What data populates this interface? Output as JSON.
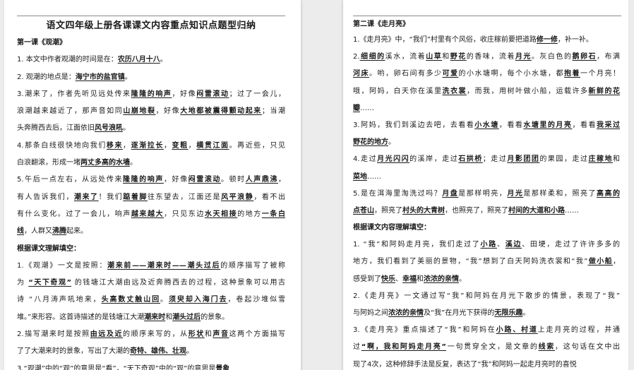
{
  "left": {
    "title": "语文四年级上册各课课文内容重点知识点题型归纳",
    "lines": [
      {
        "type": "heading",
        "segs": [
          {
            "t": "第一课《观潮》"
          }
        ]
      },
      {
        "segs": [
          {
            "t": "1. 本文中作者观潮的时间是在："
          },
          {
            "t": "农历八月十八",
            "u": true
          },
          {
            "t": "。"
          }
        ],
        "last": true
      },
      {
        "segs": [
          {
            "t": "2. 观潮的地点是："
          },
          {
            "t": "海宁市的盐官镇",
            "u": true
          },
          {
            "t": "。"
          }
        ],
        "last": true
      },
      {
        "segs": [
          {
            "t": "3.潮来了，作者先听见远处传来"
          },
          {
            "t": "隆隆的响声",
            "u": true
          },
          {
            "t": "，好像"
          },
          {
            "t": "闷雷滚动",
            "u": true
          },
          {
            "t": "；过了一会儿，"
          }
        ]
      },
      {
        "segs": [
          {
            "t": "浪潮越来越近了，那声音如同"
          },
          {
            "t": "山崩地裂",
            "u": true
          },
          {
            "t": "，好像"
          },
          {
            "t": "大地都被震得颤动起来",
            "u": true
          },
          {
            "t": "；当潮"
          }
        ]
      },
      {
        "segs": [
          {
            "t": "头奔腾西去后，江面依旧"
          },
          {
            "t": "风号浪吼",
            "u": true
          },
          {
            "t": "。"
          }
        ],
        "last": true
      },
      {
        "segs": [
          {
            "t": "4.那条白线很快地向我们"
          },
          {
            "t": "移来",
            "u": true
          },
          {
            "t": "，"
          },
          {
            "t": "逐渐拉长",
            "u": true
          },
          {
            "t": "，"
          },
          {
            "t": "变粗",
            "u": true
          },
          {
            "t": "，"
          },
          {
            "t": "横贯江面",
            "u": true
          },
          {
            "t": "。再近些，只见"
          }
        ]
      },
      {
        "segs": [
          {
            "t": "白浪翻滚，形成一堵"
          },
          {
            "t": "两丈多高的水墙",
            "u": true
          },
          {
            "t": "。"
          }
        ],
        "last": true
      },
      {
        "segs": [
          {
            "t": "5.午后一点左右，从远处传来"
          },
          {
            "t": "隆隆的响声",
            "u": true
          },
          {
            "t": "，好像"
          },
          {
            "t": "闷雷滚动",
            "u": true
          },
          {
            "t": "。顿时"
          },
          {
            "t": "人声鼎沸",
            "u": true
          },
          {
            "t": "，"
          }
        ]
      },
      {
        "segs": [
          {
            "t": "有人告诉我们，"
          },
          {
            "t": "潮来了",
            "u": true
          },
          {
            "t": "！我们"
          },
          {
            "t": "踮着脚",
            "u": true
          },
          {
            "t": "往东望去，江面还是"
          },
          {
            "t": "风平浪静",
            "u": true
          },
          {
            "t": "，看不出"
          }
        ]
      },
      {
        "segs": [
          {
            "t": "有什么变化。过了一会儿，响声"
          },
          {
            "t": "越来越大",
            "u": true
          },
          {
            "t": "，只见东边"
          },
          {
            "t": "水天相接",
            "u": true
          },
          {
            "t": "的地方"
          },
          {
            "t": "一条白",
            "u": true
          }
        ]
      },
      {
        "segs": [
          {
            "t": "线",
            "u": true
          },
          {
            "t": "，人群又"
          },
          {
            "t": "沸腾",
            "u": true
          },
          {
            "t": "起来。"
          }
        ],
        "last": true
      },
      {
        "type": "heading",
        "segs": [
          {
            "t": "根据课文理解填空："
          }
        ]
      },
      {
        "segs": [
          {
            "t": "1.《观潮》一文是按照："
          },
          {
            "t": "潮来前——潮来时——潮头过后",
            "u": true
          },
          {
            "t": "的顺序描写了被称"
          }
        ]
      },
      {
        "segs": [
          {
            "t": "为 "
          },
          {
            "t": "“天下奇观”",
            "u": true
          },
          {
            "t": " 的钱塘江大潮由远及近奔腾西去的过程，这种景象可以用古"
          }
        ]
      },
      {
        "segs": [
          {
            "t": "诗 “八月涛声吼地来，"
          },
          {
            "t": "头高数丈触山回",
            "u": true
          },
          {
            "t": "。"
          },
          {
            "t": "须臾却入海门去",
            "u": true
          },
          {
            "t": "，卷起沙堆似雪"
          }
        ]
      },
      {
        "segs": [
          {
            "t": "堆。”来形容。这首诗描述的是钱塘江大潮"
          },
          {
            "t": "潮来时",
            "u": true
          },
          {
            "t": "和"
          },
          {
            "t": "潮头过后",
            "u": true
          },
          {
            "t": "的景象。"
          }
        ],
        "last": true
      },
      {
        "segs": [
          {
            "t": "2.描写潮来时是按照"
          },
          {
            "t": "由远及近",
            "u": true
          },
          {
            "t": "的顺序来写的，从"
          },
          {
            "t": "形状",
            "u": true
          },
          {
            "t": "和"
          },
          {
            "t": "声音",
            "u": true
          },
          {
            "t": "这两个方面描写"
          }
        ]
      },
      {
        "segs": [
          {
            "t": "了了大潮来时的景象，写出了大潮的"
          },
          {
            "t": "奇特、雄伟、壮观",
            "u": true
          },
          {
            "t": "。"
          }
        ],
        "last": true
      },
      {
        "segs": [
          {
            "t": "3.“观潮”中的“观”的意思是“看”，“天下奇观”中的“观”的意思是"
          },
          {
            "t": "景象",
            "u": true
          }
        ],
        "last": true
      }
    ]
  },
  "right": {
    "lines": [
      {
        "type": "heading",
        "segs": [
          {
            "t": "第二课《走月亮》"
          }
        ],
        "first": true
      },
      {
        "segs": [
          {
            "t": "1.《走月亮》中，“我们”村里有个风俗，收庄稼前要把道路"
          },
          {
            "t": "修一修",
            "u": true
          },
          {
            "t": "，补一补。"
          }
        ],
        "last": true
      },
      {
        "segs": [
          {
            "t": "2."
          },
          {
            "t": "细细的",
            "u": true
          },
          {
            "t": "溪水，流着"
          },
          {
            "t": "山草",
            "u": true
          },
          {
            "t": "和"
          },
          {
            "t": "野花",
            "u": true
          },
          {
            "t": "的香味，流着"
          },
          {
            "t": "月光",
            "u": true
          },
          {
            "t": "。灰白色的"
          },
          {
            "t": "鹅卵石",
            "u": true
          },
          {
            "t": "，布满"
          }
        ]
      },
      {
        "segs": [
          {
            "t": "河床",
            "u": true
          },
          {
            "t": "。哟，卵石间有多少"
          },
          {
            "t": "可爱",
            "u": true
          },
          {
            "t": "的小水塘啊，每个小水塘，都"
          },
          {
            "t": "抱着",
            "u": true
          },
          {
            "t": "一个月亮！"
          }
        ]
      },
      {
        "segs": [
          {
            "t": "哦，阿妈，白天你在溪里"
          },
          {
            "t": "洗衣裳",
            "u": true
          },
          {
            "t": "，而我，用树叶做小船，运载许多"
          },
          {
            "t": "新鲜的花",
            "u": true
          }
        ]
      },
      {
        "segs": [
          {
            "t": "瓣",
            "u": true
          },
          {
            "t": "……"
          }
        ],
        "last": true
      },
      {
        "segs": [
          {
            "t": "3.阿妈，我们到溪边去吧，去看看"
          },
          {
            "t": "小水塘",
            "u": true
          },
          {
            "t": "，看看"
          },
          {
            "t": "水塘里的月亮",
            "u": true
          },
          {
            "t": "，看看"
          },
          {
            "t": "我采过",
            "u": true
          }
        ]
      },
      {
        "segs": [
          {
            "t": "野花的地方",
            "u": true
          },
          {
            "t": "。"
          }
        ],
        "last": true
      },
      {
        "segs": [
          {
            "t": "4.走过"
          },
          {
            "t": "月光闪闪",
            "u": true
          },
          {
            "t": "的溪岸，走过"
          },
          {
            "t": "石拱桥",
            "u": true
          },
          {
            "t": "；走过"
          },
          {
            "t": "月影团团",
            "u": true
          },
          {
            "t": "的果园，走过"
          },
          {
            "t": "庄稼地",
            "u": true
          },
          {
            "t": "和"
          }
        ]
      },
      {
        "segs": [
          {
            "t": "菜地",
            "u": true
          },
          {
            "t": "……"
          }
        ],
        "last": true
      },
      {
        "segs": [
          {
            "t": "5.是在洱海里淘洗过吗？"
          },
          {
            "t": "月盘",
            "u": true
          },
          {
            "t": "是那样明亮，"
          },
          {
            "t": "月光",
            "u": true
          },
          {
            "t": "是那样柔和，照亮了"
          },
          {
            "t": "高高的",
            "u": true
          }
        ]
      },
      {
        "segs": [
          {
            "t": "点苍山",
            "u": true
          },
          {
            "t": "，照亮了"
          },
          {
            "t": "村头的大青树",
            "u": true
          },
          {
            "t": "，也照亮了，照亮了"
          },
          {
            "t": "村间的大道和小路",
            "u": true
          },
          {
            "t": "……"
          }
        ],
        "last": true
      },
      {
        "type": "heading",
        "segs": [
          {
            "t": "根据课文内容理解填空："
          }
        ]
      },
      {
        "segs": [
          {
            "t": "1. “我”和阿妈走月亮，我们走过了"
          },
          {
            "t": "小路",
            "u": true
          },
          {
            "t": "、"
          },
          {
            "t": "溪边",
            "u": true
          },
          {
            "t": "、田埂，走过了许许多多的"
          }
        ]
      },
      {
        "segs": [
          {
            "t": "地方，我们看到了美丽的景物，“我”想到了白天阿妈洗衣裳和“我”"
          },
          {
            "t": "做小船",
            "u": true
          },
          {
            "t": "，"
          }
        ]
      },
      {
        "segs": [
          {
            "t": "感受到了"
          },
          {
            "t": "快乐",
            "u": true
          },
          {
            "t": "、"
          },
          {
            "t": "幸福",
            "u": true
          },
          {
            "t": "和"
          },
          {
            "t": "浓浓的亲情",
            "u": true
          },
          {
            "t": "。"
          }
        ],
        "last": true
      },
      {
        "segs": [
          {
            "t": "2.《走月亮》一文通过写“我”和阿妈在月光下散步的情景，表现了“我”"
          }
        ]
      },
      {
        "segs": [
          {
            "t": "与阿妈之间"
          },
          {
            "t": "浓浓的亲情",
            "u": true
          },
          {
            "t": "及“我”在月光下获得的"
          },
          {
            "t": "无限乐趣",
            "u": true
          },
          {
            "t": "。"
          }
        ],
        "last": true
      },
      {
        "segs": [
          {
            "t": "3.《走月亮》重点描述了“我”和阿妈在"
          },
          {
            "t": "小路、村道",
            "u": true
          },
          {
            "t": "上走月亮的过程，并通"
          }
        ]
      },
      {
        "segs": [
          {
            "t": "过"
          },
          {
            "t": "“啊，我和阿妈走月亮”",
            "u": true
          },
          {
            "t": "一句贯穿全文，是文章的"
          },
          {
            "t": "线索",
            "u": true
          },
          {
            "t": "，这句话在文中出"
          }
        ]
      },
      {
        "segs": [
          {
            "t": "现了4次，这种修辞手法是反复，表达了“我”和阿妈一起走月亮时的喜悦"
          }
        ],
        "last": true
      }
    ]
  }
}
